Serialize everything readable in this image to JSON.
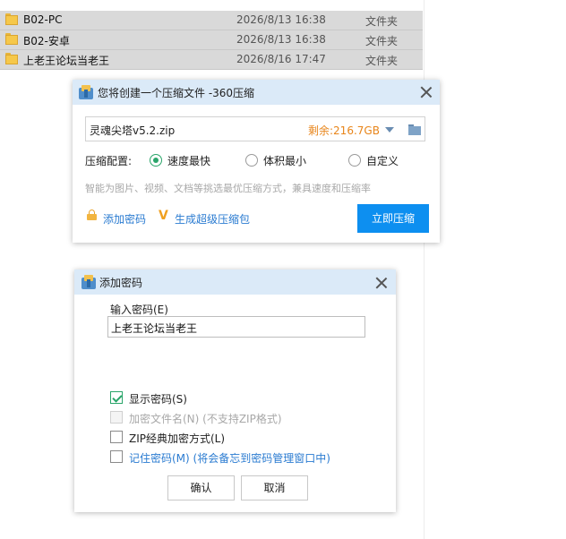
{
  "files": [
    {
      "name": "B02-PC",
      "date": "2026/8/13 16:38",
      "type": "文件夹"
    },
    {
      "name": "B02-安卓",
      "date": "2026/8/13 16:38",
      "type": "文件夹"
    },
    {
      "name": "上老王论坛当老王",
      "date": "2026/8/16 17:47",
      "type": "文件夹"
    }
  ],
  "compress_dialog": {
    "title": "您将创建一个压缩文件 -360压缩",
    "filename": "灵魂尖塔v5.2.zip",
    "remaining": "剩余:216.7GB",
    "config_label": "压缩配置:",
    "options": [
      "速度最快",
      "体积最小",
      "自定义"
    ],
    "selected_option": "速度最快",
    "hint": "智能为图片、视频、文档等挑选最优压缩方式，兼具速度和压缩率",
    "add_password": "添加密码",
    "super_pack": "生成超级压缩包",
    "compress_button": "立即压缩",
    "accent_color": "#0d8ff0",
    "remaining_color": "#e8851a"
  },
  "password_dialog": {
    "title": "添加密码",
    "input_label": "输入密码(E)",
    "password_value": "上老王论坛当老王",
    "show_password": "显示密码(S)",
    "show_password_checked": true,
    "encrypt_filename": "加密文件名(N) (不支持ZIP格式)",
    "encrypt_filename_enabled": false,
    "zip_classic": "ZIP经典加密方式(L)",
    "remember_password": "记住密码(M) (将会备忘到密码管理窗口中)",
    "ok_button": "确认",
    "cancel_button": "取消",
    "link_color": "#2a7bd1"
  }
}
